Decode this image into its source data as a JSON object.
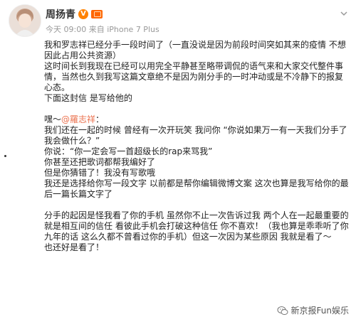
{
  "post": {
    "author_name": "周扬青",
    "vip_badge": "V",
    "meta": "今天 09:00 来自 iPhone 7 Plus"
  },
  "content": {
    "p1": "我和罗志祥已经分手一段时间了（一直没说是因为前段时间突如其来的疫情 不想因此占用公共资源）",
    "p2": "这时间长到我现在已经可以用完全平静甚至略带调侃的语气来和大家交代整件事情，当然也久到我写这篇文章绝不是因为刚分手的一时冲动或是不冷静下的报复心态。",
    "p3": "下面这封信 是写给他的",
    "mention_prefix": "嘿～",
    "mention": "@羅志祥",
    "colon": "：",
    "p4": "我们还在一起的时候 曾经有一次开玩笑 我问你 “你说如果万一有一天我们分手了 我会做什么？”",
    "p5": "你说：“你一定会写一首超级长的rap来骂我”",
    "p6": "你甚至还把歌词都帮我编好了",
    "p7": "但是你猜错了！我没有写歌哦",
    "p8": "我还是选择给你写一段文字 以前都是帮你编辑微博文案 这次也算是我写给你的最后一篇长篇文字了",
    "p9": "分手的起因是怪我看了你的手机 虽然你不止一次告诉过我 两个人在一起最重要的就是相互间的信任 看彼此手机会打破这种信任 你不喜欢！（我也算是乖乖听了你九年的话 这么久都不曾看过你的手机）但这一次因为某些原因 我就是看了～",
    "p10": "也还好是看了！"
  },
  "watermark": {
    "text": "新京报Fun娱乐"
  },
  "colors": {
    "mention": "#eb7350",
    "meta": "#999999",
    "badge": "#ff8200"
  }
}
